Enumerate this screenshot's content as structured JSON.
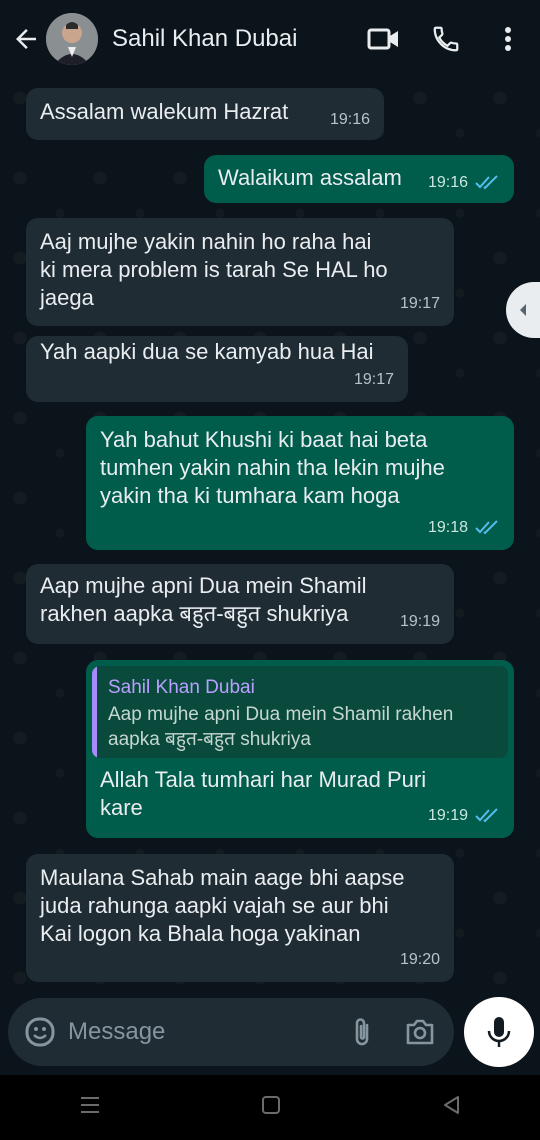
{
  "header": {
    "contact_name": "Sahil Khan Dubai"
  },
  "messages": [
    {
      "dir": "in",
      "text": "Assalam walekum Hazrat",
      "time": "19:16"
    },
    {
      "dir": "out",
      "text": "Walaikum assalam",
      "time": "19:16"
    },
    {
      "dir": "in",
      "text": "Aaj mujhe yakin nahin ho raha hai\nki mera problem is tarah Se HAL ho\njaega",
      "time": "19:17"
    },
    {
      "dir": "in",
      "text": "Yah aapki dua se kamyab hua Hai",
      "time": "19:17"
    },
    {
      "dir": "out",
      "text": "Yah bahut Khushi ki baat hai beta\ntumhen yakin nahin tha lekin mujhe\nyakin tha ki tumhara kam hoga",
      "time": "19:18"
    },
    {
      "dir": "in",
      "text": "Aap mujhe apni Dua mein Shamil\nrakhen aapka बहुत-बहुत shukriya",
      "time": "19:19"
    },
    {
      "dir": "out",
      "quote_name": "Sahil Khan Dubai",
      "quote_text": "Aap mujhe apni Dua mein Shamil rakhen\naapka बहुत-बहुत shukriya",
      "text": "Allah Tala tumhari har Murad Puri\nkare",
      "time": "19:19"
    },
    {
      "dir": "in",
      "text": "Maulana Sahab main aage bhi aapse\njuda rahunga aapki vajah se aur bhi\nKai logon ka Bhala hoga yakinan",
      "time": "19:20"
    }
  ],
  "composer": {
    "placeholder": "Message"
  },
  "colors": {
    "incoming_bubble": "#202c33",
    "outgoing_bubble": "#005c4b",
    "read_ticks": "#53bdeb",
    "background": "#0b141a"
  }
}
